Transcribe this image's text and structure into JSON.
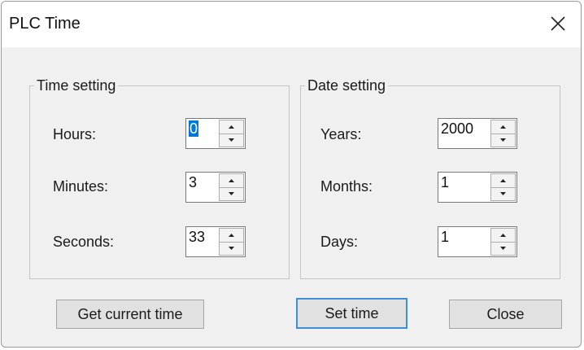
{
  "window": {
    "title": "PLC Time"
  },
  "time_setting": {
    "legend": "Time setting",
    "fields": [
      {
        "label": "Hours:",
        "value": "0",
        "selected": true
      },
      {
        "label": "Minutes:",
        "value": "3"
      },
      {
        "label": "Seconds:",
        "value": "33"
      }
    ]
  },
  "date_setting": {
    "legend": "Date setting",
    "fields": [
      {
        "label": "Years:",
        "value": "2000"
      },
      {
        "label": "Months:",
        "value": "1"
      },
      {
        "label": "Days:",
        "value": "1"
      }
    ]
  },
  "buttons": {
    "get_current_time": "Get current time",
    "set_time": "Set time",
    "close": "Close"
  },
  "icons": {
    "close": "close-icon",
    "spin_up": "spin-up-arrow-icon",
    "spin_down": "spin-down-arrow-icon"
  },
  "colors": {
    "selection": "#0078d7",
    "default_button_border": "#3e8fd8"
  }
}
